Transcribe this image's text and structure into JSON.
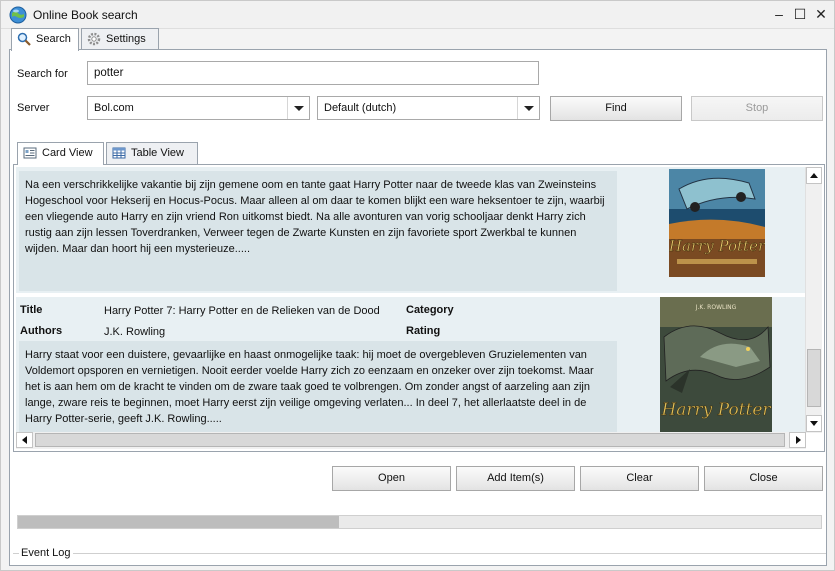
{
  "window": {
    "title": "Online Book search",
    "controls": {
      "minimize": "–",
      "maximize": "☐",
      "close": "✕"
    }
  },
  "tabs_top": [
    {
      "label": "Search",
      "icon": "magnifier-icon",
      "active": true
    },
    {
      "label": "Settings",
      "icon": "gear-icon",
      "active": false
    }
  ],
  "search": {
    "search_for_label": "Search for",
    "query": "potter",
    "server_label": "Server",
    "server_value": "Bol.com",
    "locale_value": "Default (dutch)",
    "find_label": "Find",
    "stop_label": "Stop"
  },
  "view_tabs": [
    {
      "label": "Card View",
      "icon": "card-icon",
      "active": true
    },
    {
      "label": "Table View",
      "icon": "table-icon",
      "active": false
    }
  ],
  "cards": [
    {
      "description": "Na een verschrikkelijke vakantie bij zijn gemene oom en tante gaat Harry Potter naar de tweede klas van Zweinsteins Hogeschool voor Hekserij en Hocus-Pocus. Maar alleen al om daar te komen blijkt een ware heksentoer te zijn, waarbij een vliegende auto Harry en zijn vriend Ron uitkomst biedt. Na alle avonturen van vorig schooljaar denkt Harry zich rustig aan zijn lessen Toverdranken, Verweer tegen de Zwarte Kunsten en zijn favoriete sport Zwerkbal te kunnen wijden. Maar dan hoort hij een mysterieuze....."
    },
    {
      "title_label": "Title",
      "title": "Harry Potter 7: Harry Potter en de Relieken van de Dood",
      "category_label": "Category",
      "category": "",
      "authors_label": "Authors",
      "authors": "J.K. Rowling",
      "rating_label": "Rating",
      "rating": "",
      "description": "Harry staat voor een duistere, gevaarlijke en haast onmogelijke taak: hij moet de overgebleven Gruzielementen van Voldemort opsporen en vernietigen. Nooit eerder voelde Harry zich zo eenzaam en onzeker over zijn toekomst. Maar het is aan hem om de kracht te vinden om de zware taak goed te volbrengen. Om zonder angst of aarzeling  aan zijn lange, zware reis te beginnen, moet Harry eerst zijn veilige omgeving verlaten...  In deel 7, het allerlaatste deel in de Harry Potter-serie, geeft J.K. Rowling....."
    }
  ],
  "buttons": {
    "open": "Open",
    "add_items": "Add Item(s)",
    "clear": "Clear",
    "close": "Close"
  },
  "progress": {
    "fraction": 0.4
  },
  "event_log": {
    "label": "Event Log"
  },
  "colors": {
    "card_bg": "#e8f0f3",
    "desc_bg": "#d9e4e8",
    "border": "#9aa3ad"
  }
}
